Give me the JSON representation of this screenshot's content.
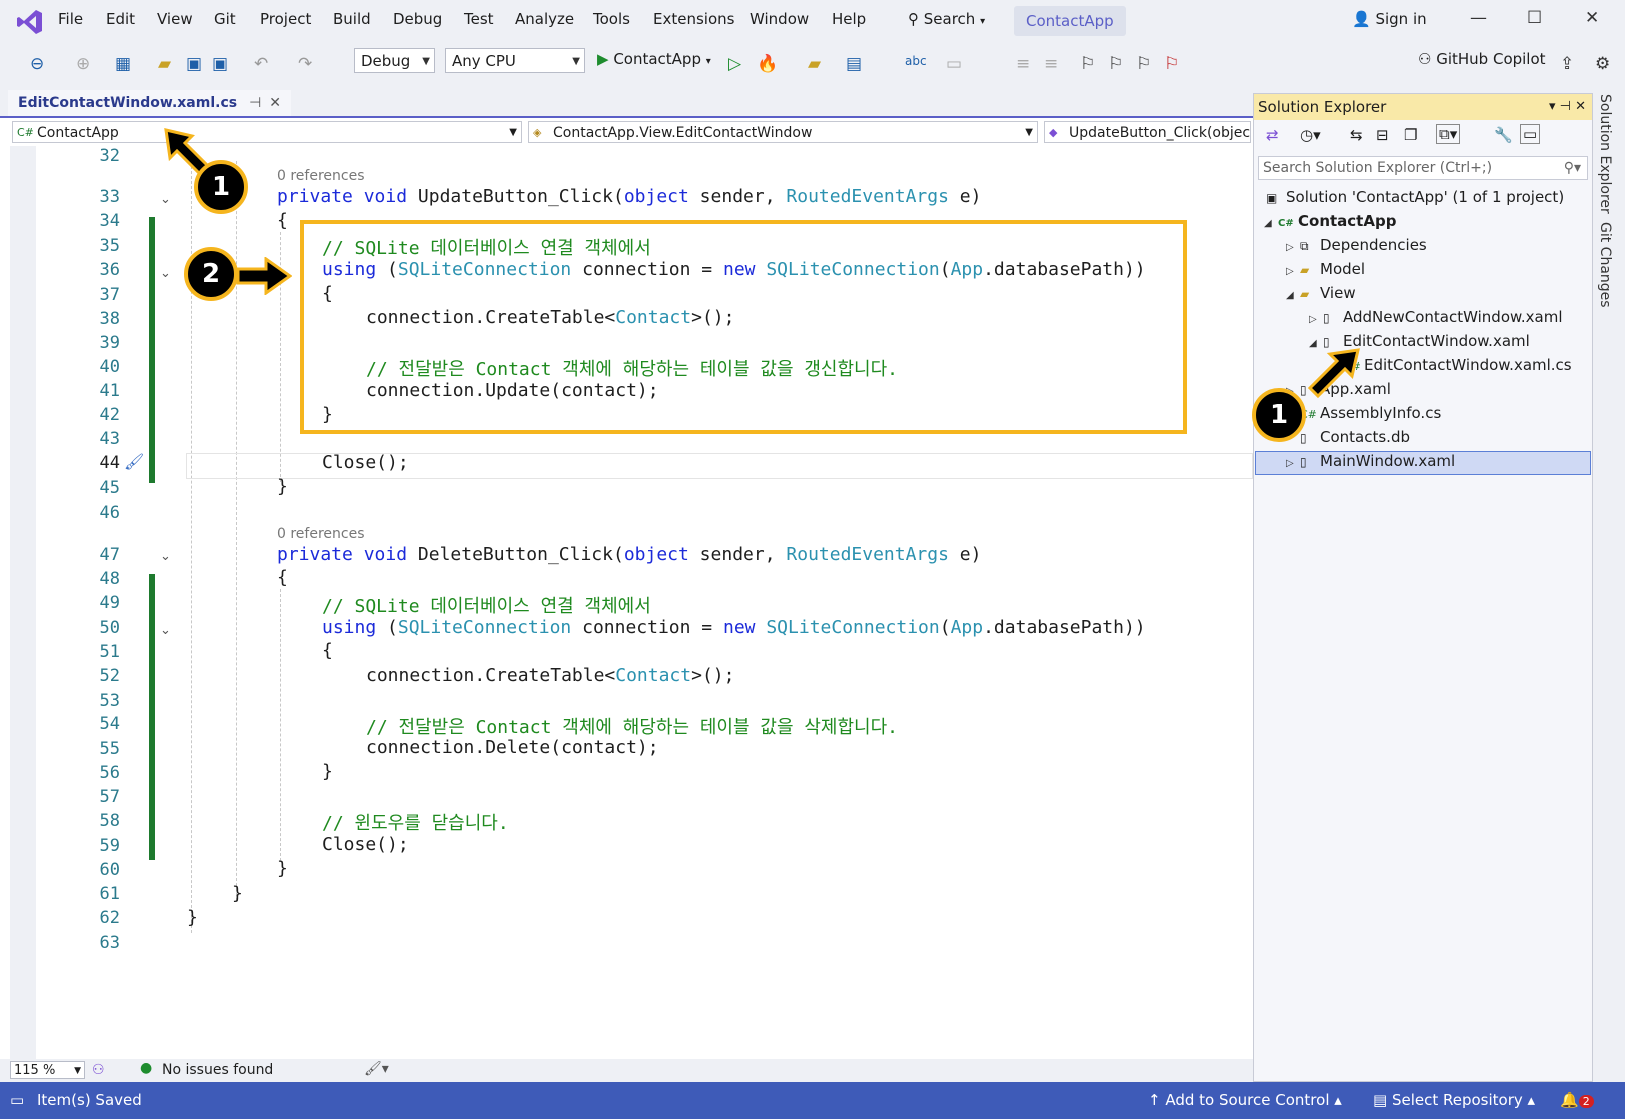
{
  "menu": [
    "File",
    "Edit",
    "View",
    "Git",
    "Project",
    "Build",
    "Debug",
    "Test",
    "Analyze",
    "Tools",
    "Extensions",
    "Window",
    "Help"
  ],
  "search_label": "Search",
  "window_title": "ContactApp",
  "sign_in": "Sign in",
  "toolbar": {
    "config": "Debug",
    "platform": "Any CPU",
    "run_target": "ContactApp",
    "copilot": "GitHub Copilot"
  },
  "tab": {
    "title": "EditContactWindow.xaml.cs"
  },
  "nav": {
    "project": "ContactApp",
    "type": "ContactApp.View.EditContactWindow",
    "member": "UpdateButton_Click(objec"
  },
  "editor": {
    "references": "0 references",
    "line_numbers": [
      "32",
      "33",
      "34",
      "35",
      "36",
      "37",
      "38",
      "39",
      "40",
      "41",
      "42",
      "43",
      "44",
      "45",
      "46",
      "47",
      "48",
      "49",
      "50",
      "51",
      "52",
      "53",
      "54",
      "55",
      "56",
      "57",
      "58",
      "59",
      "60",
      "61",
      "62",
      "63"
    ],
    "comment_connect": "// SQLite 데이터베이스 연결 객체에서",
    "comment_update": "// 전달받은 Contact 객체에 해당하는 테이블 값을 갱신합니다.",
    "comment_delete": "// 전달받은 Contact 객체에 해당하는 테이블 값을 삭제합니다.",
    "comment_close": "// 윈도우를 닫습니다."
  },
  "editor_status": {
    "zoom": "115 %",
    "issues": "No issues found"
  },
  "solution_explorer": {
    "title": "Solution Explorer",
    "search_placeholder": "Search Solution Explorer (Ctrl+;)",
    "items": [
      {
        "label": "Solution 'ContactApp' (1 of 1 project)"
      },
      {
        "label": "ContactApp"
      },
      {
        "label": "Dependencies"
      },
      {
        "label": "Model"
      },
      {
        "label": "View"
      },
      {
        "label": "AddNewContactWindow.xaml"
      },
      {
        "label": "EditContactWindow.xaml"
      },
      {
        "label": "EditContactWindow.xaml.cs"
      },
      {
        "label": "App.xaml"
      },
      {
        "label": "AssemblyInfo.cs"
      },
      {
        "label": "Contacts.db"
      },
      {
        "label": "MainWindow.xaml"
      }
    ]
  },
  "side_tabs": [
    "Solution Explorer",
    "Git Changes"
  ],
  "status": {
    "left": "Item(s) Saved",
    "source_control": "Add to Source Control",
    "repo": "Select Repository",
    "notif_count": "2"
  },
  "callouts": [
    "1",
    "2",
    "1"
  ],
  "colors": {
    "accent": "#5b5fc7",
    "status_bar": "#3e5bb8",
    "highlight": "#f5b51e",
    "change_bar": "#1e7a2e"
  }
}
